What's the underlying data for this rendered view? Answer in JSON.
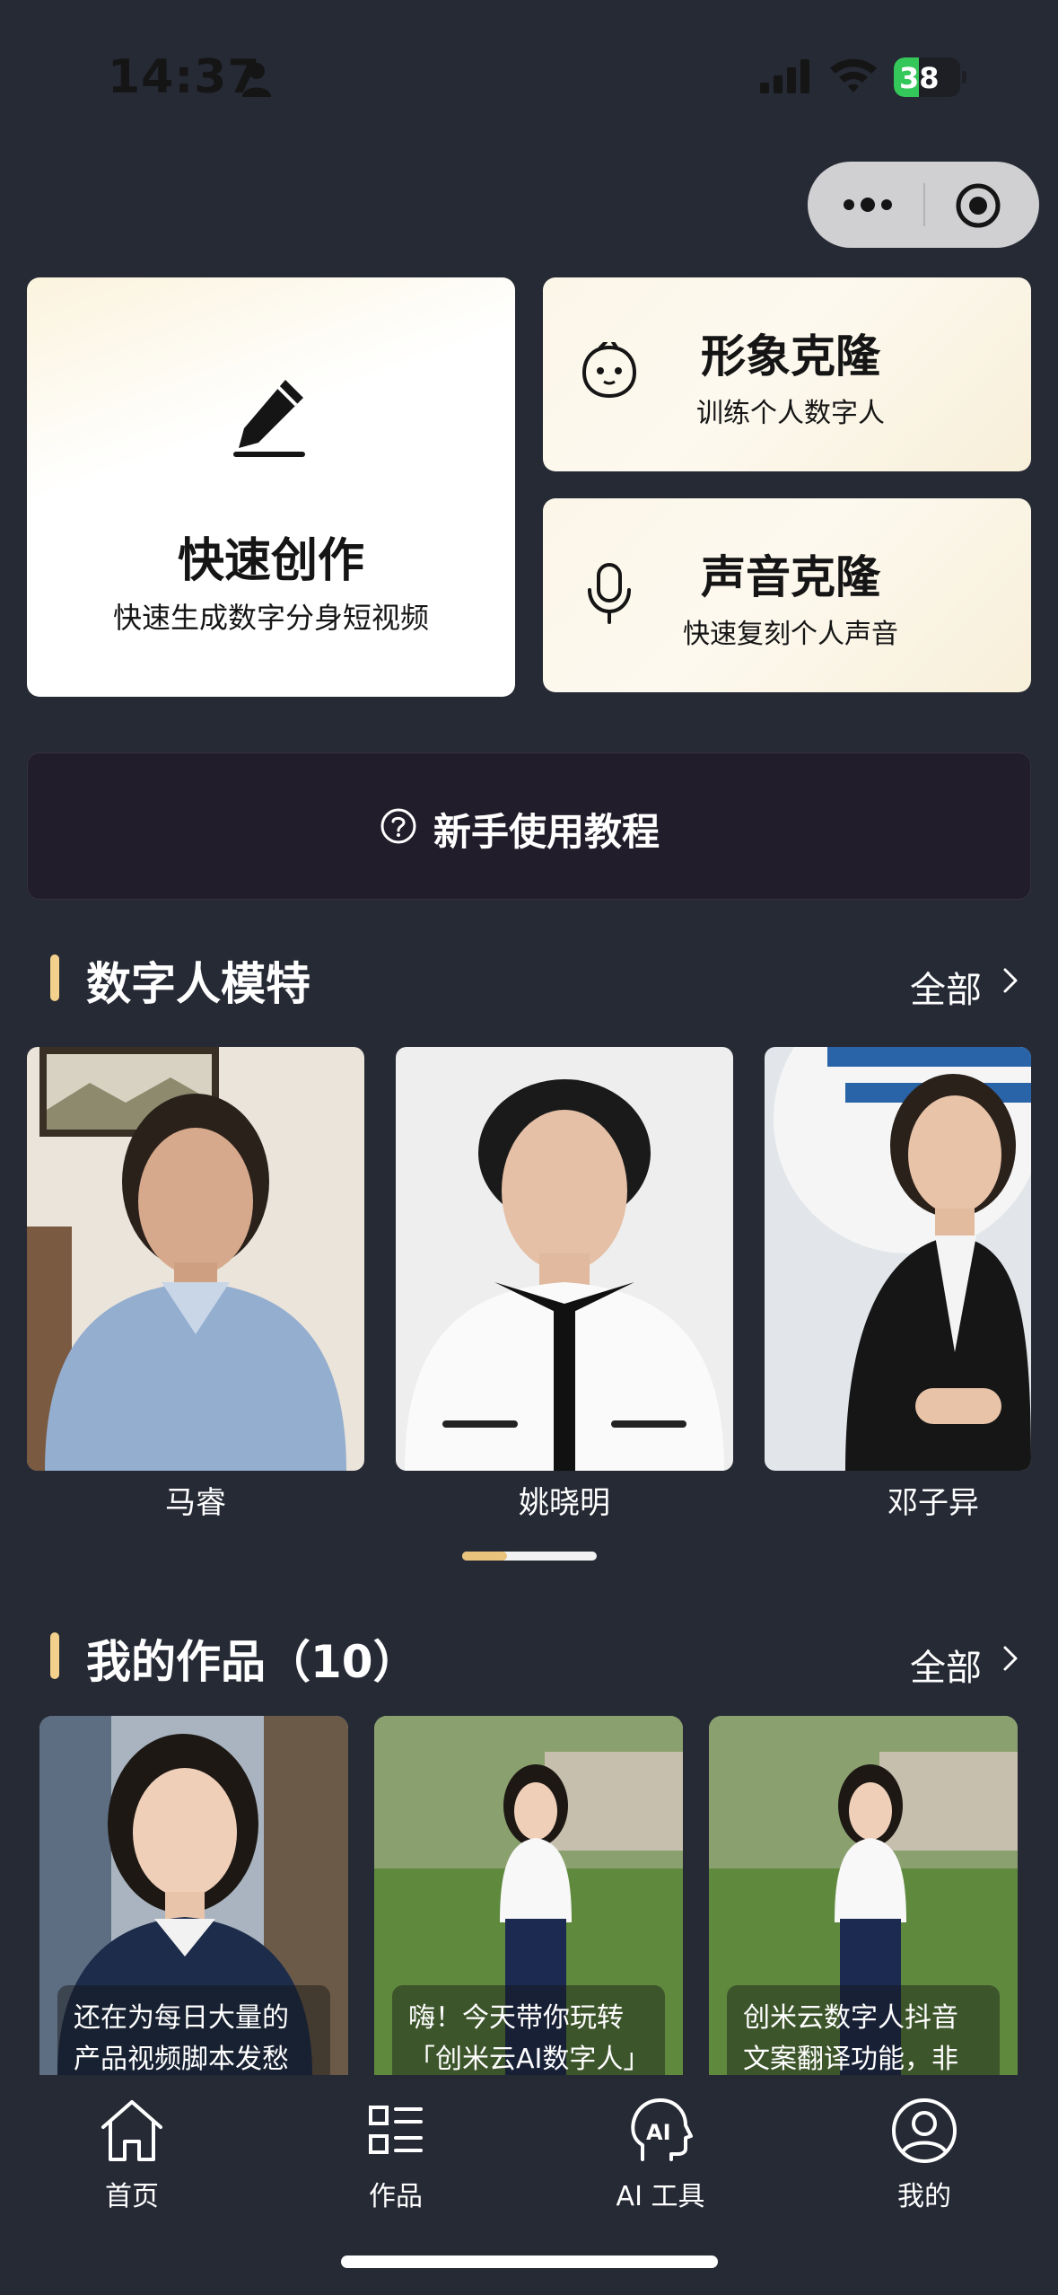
{
  "status_bar": {
    "time": "14:37",
    "battery": "38",
    "battery_level": 0.38
  },
  "actions": {
    "quick_create": {
      "title": "快速创作",
      "subtitle": "快速生成数字分身短视频"
    },
    "image_clone": {
      "title": "形象克隆",
      "subtitle": "训练个人数字人"
    },
    "voice_clone": {
      "title": "声音克隆",
      "subtitle": "快速复刻个人声音"
    }
  },
  "tutorial": {
    "label": "新手使用教程"
  },
  "models_section": {
    "title": "数字人模特",
    "see_all": "全部",
    "items": [
      {
        "name": "马睿"
      },
      {
        "name": "姚晓明"
      },
      {
        "name": "邓子异"
      }
    ]
  },
  "works_section": {
    "title": "我的作品（10）",
    "see_all": "全部",
    "items": [
      {
        "caption": "还在为每日大量的产品视频脚本发愁吗"
      },
      {
        "caption": "嗨！今天带你玩转「创米云AI数字人」"
      },
      {
        "caption": "创米云数字人抖音文案翻译功能，非常"
      }
    ]
  },
  "tabbar": {
    "items": [
      {
        "label": "首页",
        "icon": "home-icon"
      },
      {
        "label": "作品",
        "icon": "works-grid-icon"
      },
      {
        "label": "AI 工具",
        "icon": "ai-head-icon"
      },
      {
        "label": "我的",
        "icon": "profile-icon"
      }
    ]
  },
  "colors": {
    "background": "#262a35",
    "accent": "#f3d08c",
    "card_cream": "#fbf6e8",
    "banner": "#221d2a"
  }
}
